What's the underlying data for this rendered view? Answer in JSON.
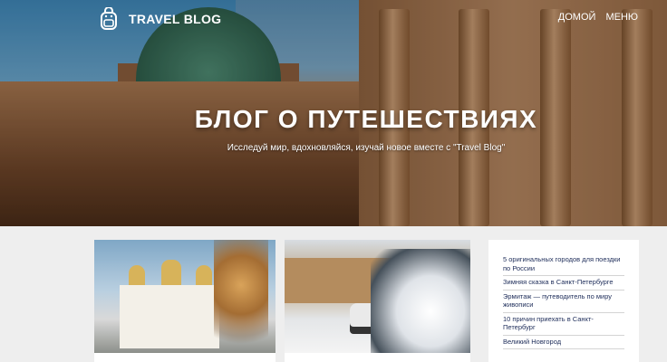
{
  "header": {
    "logo_text": "TRAVEL BLOG",
    "logo_icon": "backpack-icon",
    "nav": [
      {
        "label": "ДОМОЙ"
      },
      {
        "label": "МЕНЮ"
      }
    ]
  },
  "hero": {
    "title": "БЛОГ О ПУТЕШЕСТВИЯХ",
    "subtitle": "Исследуй мир, вдохновляйся, изучай новое вместе с \"Travel Blog\""
  },
  "sidebar": {
    "links": [
      {
        "label": "5 оригинальных городов для поездки по России"
      },
      {
        "label": "Зимняя сказка в Санкт-Петербурге"
      },
      {
        "label": "Эрмитаж — путеводитель по миру живописи"
      },
      {
        "label": "10 причин приехать в Санкт-Петербург"
      },
      {
        "label": "Великий Новгород"
      }
    ]
  },
  "colors": {
    "link": "#1e2d5a",
    "page_bg": "#eeeeee",
    "card_bg": "#ffffff"
  }
}
